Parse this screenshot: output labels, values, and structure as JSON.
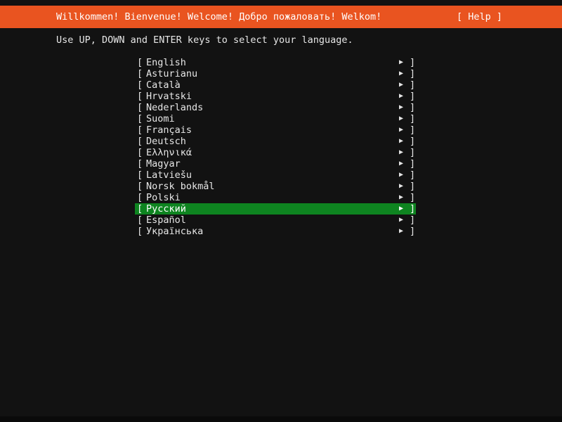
{
  "header": {
    "title": "Willkommen! Bienvenue! Welcome! Добро пожаловать! Welkom!",
    "help_label": "[ Help ]"
  },
  "instructions": "Use UP, DOWN and ENTER keys to select your language.",
  "languages": {
    "bracket_left": "[",
    "bracket_right": "]",
    "arrow_icon": "▶",
    "selected_index": 13,
    "items": [
      {
        "label": "English"
      },
      {
        "label": "Asturianu"
      },
      {
        "label": "Català"
      },
      {
        "label": "Hrvatski"
      },
      {
        "label": "Nederlands"
      },
      {
        "label": "Suomi"
      },
      {
        "label": "Français"
      },
      {
        "label": "Deutsch"
      },
      {
        "label": "Ελληνικά"
      },
      {
        "label": "Magyar"
      },
      {
        "label": "Latviešu"
      },
      {
        "label": "Norsk bokmål"
      },
      {
        "label": "Polski"
      },
      {
        "label": "Русский"
      },
      {
        "label": "Español"
      },
      {
        "label": "Українська"
      }
    ]
  },
  "colors": {
    "header_bg": "#e95420",
    "selected_bg": "#0e8420",
    "background": "#121212"
  }
}
